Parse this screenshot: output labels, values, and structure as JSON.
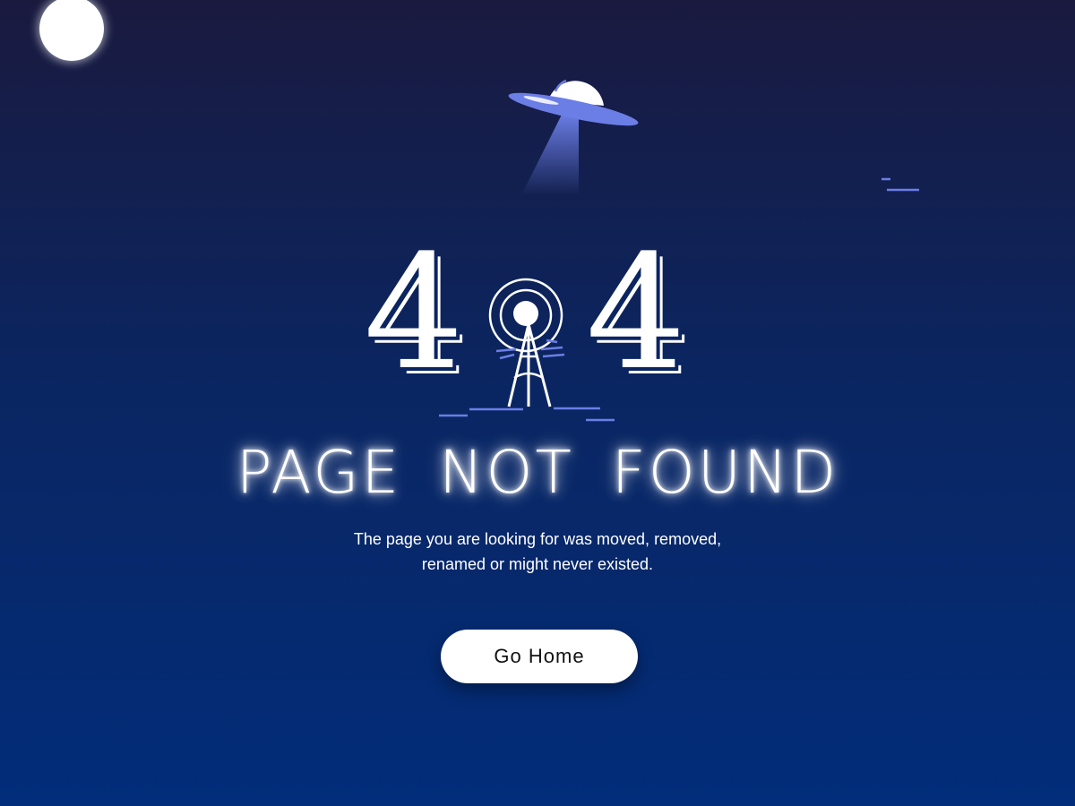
{
  "colors": {
    "background_top": "#1a1a3f",
    "background_bottom": "#022d7a",
    "accent": "#6b7ee6",
    "text": "#ffffff",
    "button_bg": "#ffffff",
    "button_text": "#111111"
  },
  "illustration": {
    "moon_icon": "moon-icon",
    "ufo_icon": "ufo-icon",
    "antenna_icon": "radio-tower-icon"
  },
  "error": {
    "digit_left": "4",
    "digit_right": "4",
    "title": "PAGE NOT FOUND",
    "message_line1": "The page you are looking for was moved, removed,",
    "message_line2": "renamed or might never existed."
  },
  "actions": {
    "go_home_label": "Go Home"
  }
}
